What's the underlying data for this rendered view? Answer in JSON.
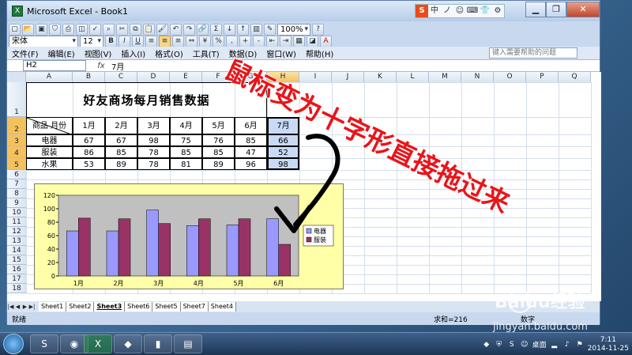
{
  "window": {
    "title": "Microsoft Excel - Book1"
  },
  "toolbar": {
    "font_name": "宋体",
    "font_size": "12",
    "zoom": "100%"
  },
  "menubar": {
    "items": [
      "文件(F)",
      "编辑(E)",
      "视图(V)",
      "插入(I)",
      "格式(O)",
      "工具(T)",
      "数据(D)",
      "窗口(W)",
      "帮助(H)"
    ],
    "help_placeholder": "键入需要帮助的问题"
  },
  "formula": {
    "name_box": "H2",
    "fx": "fx",
    "value": "7月"
  },
  "columns": [
    "A",
    "B",
    "C",
    "D",
    "E",
    "F",
    "G",
    "H",
    "I",
    "J",
    "K",
    "L",
    "M",
    "N",
    "O",
    "P",
    "Q"
  ],
  "rows": [
    "1",
    "2",
    "3",
    "4",
    "5",
    "6",
    "7",
    "8",
    "9",
    "10",
    "11",
    "12",
    "13",
    "14",
    "15",
    "16",
    "17",
    "18"
  ],
  "table": {
    "title": "好友商场每月销售数据",
    "corner_top": "月份",
    "corner_bottom": "商品",
    "months": [
      "1月",
      "2月",
      "3月",
      "4月",
      "5月",
      "6月",
      "7月"
    ],
    "items": [
      {
        "name": "电器",
        "values": [
          "67",
          "67",
          "98",
          "75",
          "76",
          "85",
          "66"
        ]
      },
      {
        "name": "服装",
        "values": [
          "86",
          "85",
          "78",
          "85",
          "85",
          "47",
          "52"
        ]
      },
      {
        "name": "水果",
        "values": [
          "53",
          "89",
          "78",
          "81",
          "89",
          "96",
          "98"
        ]
      }
    ]
  },
  "annotation": {
    "text": "鼠标变为十字形直接拖过来"
  },
  "chart_data": {
    "type": "bar",
    "categories": [
      "1月",
      "2月",
      "3月",
      "4月",
      "5月",
      "6月"
    ],
    "series": [
      {
        "name": "电器",
        "values": [
          67,
          67,
          98,
          75,
          76,
          85
        ],
        "color": "#9999ff"
      },
      {
        "name": "服装",
        "values": [
          86,
          85,
          78,
          85,
          85,
          47
        ],
        "color": "#993366"
      }
    ],
    "ylim": [
      0,
      120
    ],
    "yticks": [
      "0",
      "20",
      "40",
      "60",
      "80",
      "100",
      "120"
    ],
    "grid": false,
    "legend_position": "right",
    "plot_background": "#c0c0c0",
    "chart_background": "#ffffa8"
  },
  "sheet_tabs": [
    "Sheet1",
    "Sheet2",
    "Sheet3",
    "Sheet6",
    "Sheet5",
    "Sheet7",
    "Sheet4"
  ],
  "active_tab": "Sheet3",
  "status": {
    "left": "就绪",
    "sum": "求和=216",
    "mode": "数字"
  },
  "taskbar": {
    "tray_label": "桌面",
    "time": "7:11",
    "date": "2014-11-25"
  },
  "watermark": {
    "brand": "Baidu经验",
    "url": "jingyan.baidu.com"
  },
  "ime": [
    "S",
    "中",
    "ノ",
    "☺",
    "⌨",
    "👕",
    "⚙"
  ]
}
